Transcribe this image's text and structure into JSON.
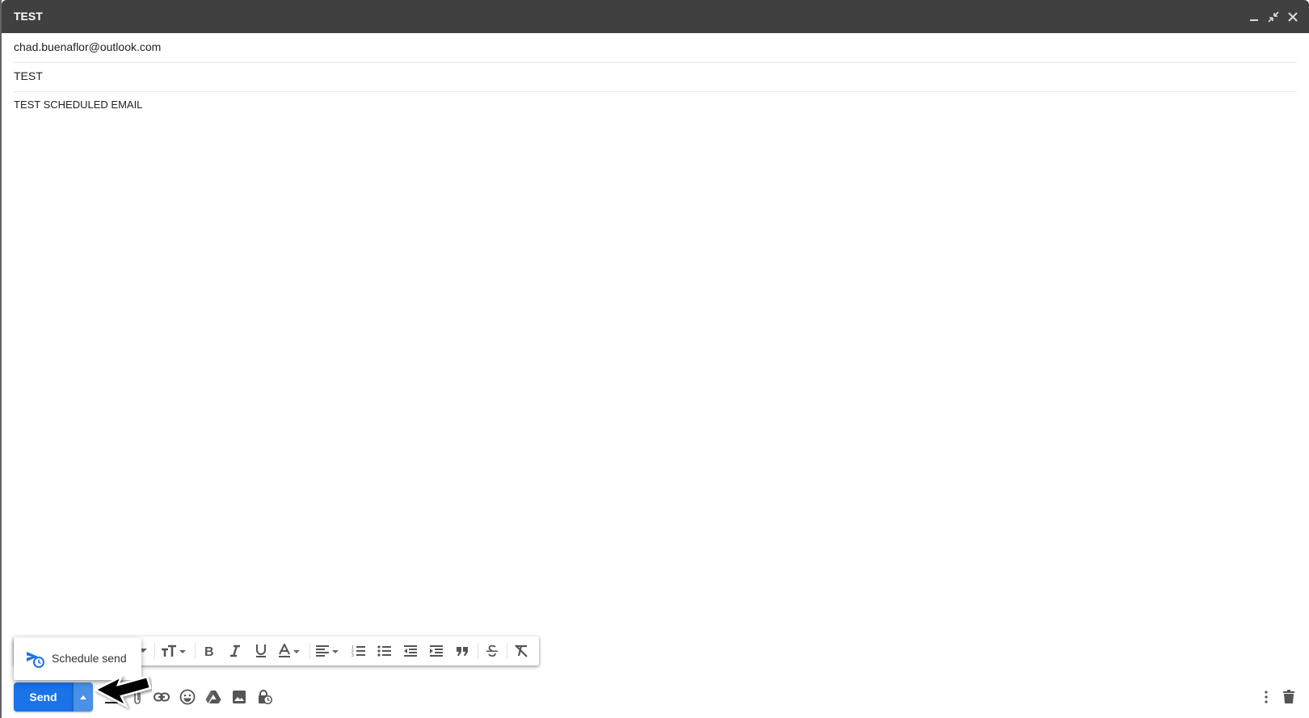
{
  "window": {
    "title": "TEST",
    "controls": [
      "minimize-icon",
      "exit-fullscreen-icon",
      "close-icon"
    ]
  },
  "compose": {
    "to": "chad.buenaflor@outlook.com",
    "subject": "TEST",
    "body": "TEST SCHEDULED EMAIL"
  },
  "format_toolbar": {
    "items": [
      "font-dropdown",
      "text-size",
      "bold",
      "italic",
      "underline",
      "text-color",
      "align",
      "numbered-list",
      "bulleted-list",
      "indent-less",
      "indent-more",
      "quote",
      "strikethrough",
      "remove-formatting"
    ]
  },
  "schedule_menu": {
    "items": [
      {
        "label": "Schedule send",
        "icon": "schedule-send-icon"
      }
    ]
  },
  "bottom_bar": {
    "send_label": "Send",
    "icons": [
      "formatting-options-icon",
      "attach-icon",
      "link-icon",
      "emoji-icon",
      "drive-icon",
      "photo-icon",
      "confidential-mode-icon"
    ],
    "right_icons": [
      "more-options-icon",
      "discard-draft-icon"
    ]
  },
  "colors": {
    "titlebar": "#404040",
    "send": "#1a73e8",
    "send_more": "#4a90e6",
    "schedule_icon": "#1a73e8"
  }
}
